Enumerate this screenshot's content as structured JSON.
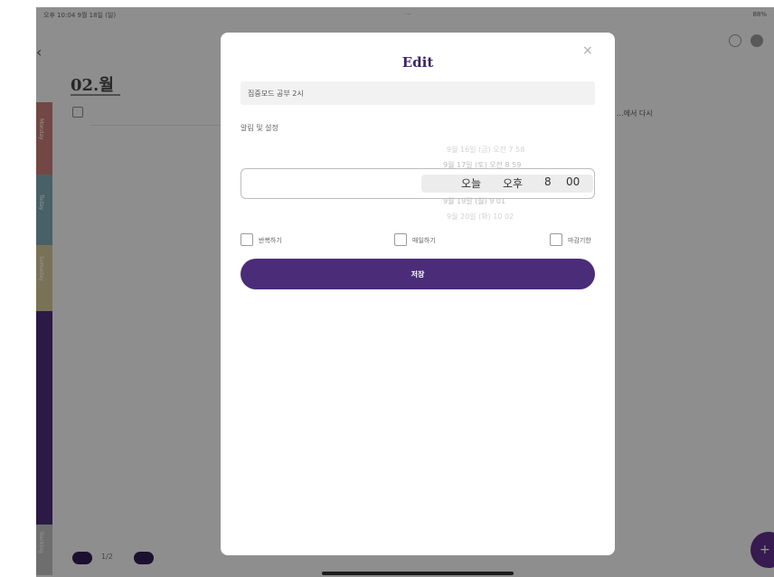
{
  "status_bar": {
    "time": "오후 10:04 9월 18일 (일)",
    "center": "···",
    "battery": "88%"
  },
  "page": {
    "date_title": "02.월",
    "bg_item_text": "...에서 다시"
  },
  "side_tabs": [
    "Monday",
    "Today",
    "Someday",
    "",
    "Backlog"
  ],
  "pager": {
    "label": "1/2"
  },
  "fab": {
    "label": "+"
  },
  "modal": {
    "title": "Edit",
    "close_label": "×",
    "task_title_value": "집중모드 공부 2시",
    "alarm_label": "알림 및 설정",
    "picker": {
      "faded_rows": [
        "9월 16일 (금) 오전 7 58",
        "9월 17일 (토) 오전 8 59",
        "9월 19일 (월) 9 01",
        "9월 20일 (화) 10 02"
      ],
      "selected": {
        "date": "오늘",
        "ampm": "오후",
        "hour": "8",
        "minute": "00"
      }
    },
    "checkboxes": [
      "반복하기",
      "매일하기",
      "마감기한"
    ],
    "save_label": "저장"
  },
  "colors": {
    "accent": "#4a2c79",
    "tab_pink": "#c77b74",
    "tab_teal": "#7ba8b0",
    "tab_beige": "#d2c595",
    "tab_grey": "#bdbdbd"
  }
}
